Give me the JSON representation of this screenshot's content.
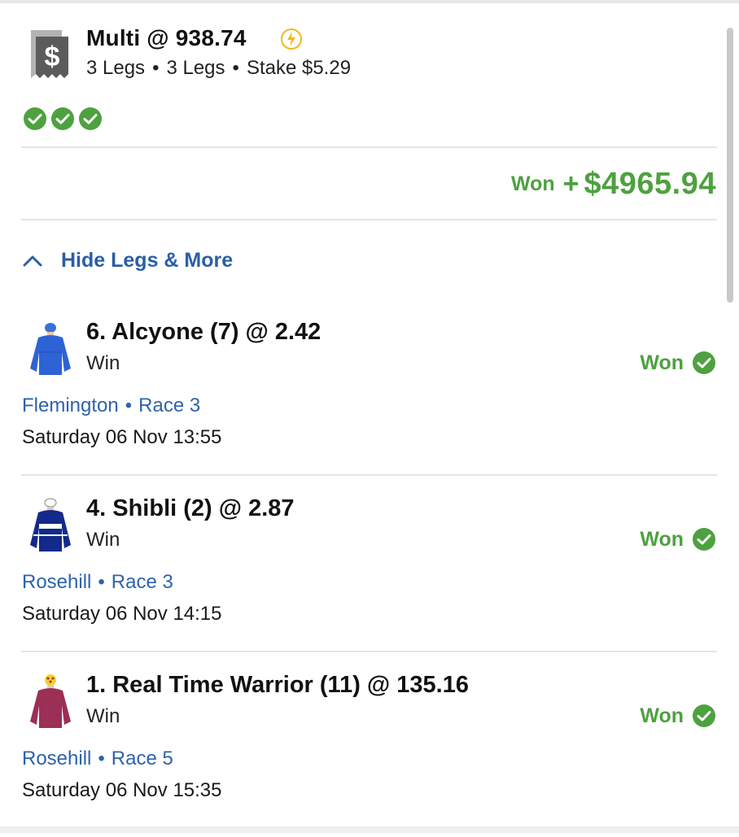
{
  "bet": {
    "title": "Multi @ 938.74",
    "legs_label_1": "3 Legs",
    "legs_label_2": "3 Legs",
    "stake": "Stake $5.29",
    "separator": "•"
  },
  "result": {
    "label": "Won",
    "plus": "+",
    "amount": "$4965.94"
  },
  "toggle": {
    "label": "Hide Legs & More"
  },
  "legs": [
    {
      "title": "6. Alcyone (7) @ 2.42",
      "type": "Win",
      "status": "Won",
      "venue": "Flemington",
      "race": "Race 3",
      "datetime": "Saturday 06 Nov 13:55",
      "silk": "blue-silk-icon"
    },
    {
      "title": "4. Shibli (2) @ 2.87",
      "type": "Win",
      "status": "Won",
      "venue": "Rosehill",
      "race": "Race 3",
      "datetime": "Saturday 06 Nov 14:15",
      "silk": "navy-silk-icon"
    },
    {
      "title": "1. Real Time Warrior (11) @ 135.16",
      "type": "Win",
      "status": "Won",
      "venue": "Rosehill",
      "race": "Race 5",
      "datetime": "Saturday 06 Nov 15:35",
      "silk": "maroon-silk-icon"
    }
  ],
  "colors": {
    "won_green": "#4ea140",
    "link_blue": "#2e63ab",
    "bolt_yellow": "#f1b81c"
  }
}
